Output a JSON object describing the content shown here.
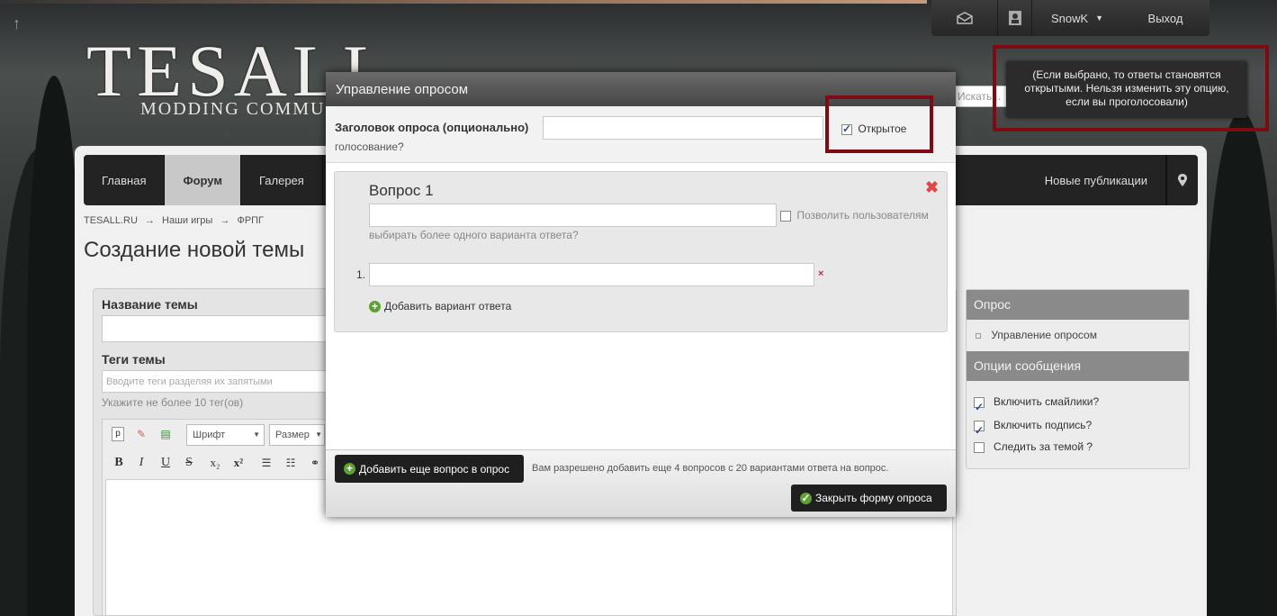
{
  "header": {
    "logo_text": "TESALL",
    "logo_sub": "MODDING COMMUNITY",
    "user_name": "SnowK",
    "logout": "Выход",
    "search_placeholder": "Искать...",
    "tooltip": "(Если выбрано, то ответы становятся открытыми. Нельзя изменить эту опцию, если вы проголосовали)"
  },
  "nav": {
    "items": [
      "Главная",
      "Форум",
      "Галерея"
    ],
    "new_posts": "Новые публикации"
  },
  "breadcrumb": [
    "TESALL.RU",
    "→",
    "Наши игры",
    "→",
    "ФРПГ"
  ],
  "page_title": "Создание новой темы",
  "form": {
    "topic_label": "Название темы",
    "tags_label": "Теги темы",
    "tags_placeholder": "Вводите теги разделяя их запятыми",
    "tags_hint": "Укажите не более 10 тег(ов)",
    "font_select": "Шрифт",
    "size_select": "Размер",
    "toolbar_icons": [
      "p",
      "✎",
      "▤",
      "B",
      "I",
      "U",
      "S",
      "x₂",
      "x²",
      "☰",
      "☷",
      "⚭"
    ]
  },
  "sidebar": {
    "poll_title": "Опрос",
    "poll_manage": "Управление опросом",
    "options_title": "Опции сообщения",
    "options": [
      {
        "label": "Включить смайлики?",
        "checked": true
      },
      {
        "label": "Включить подпись?",
        "checked": true
      },
      {
        "label": "Следить за темой ?",
        "checked": false
      }
    ]
  },
  "modal": {
    "title": "Управление опросом",
    "poll_title_label": "Заголовок опроса (опционально)",
    "poll_title_value": "",
    "open_vote_label": "Открытое",
    "open_vote_label_2": "голосование?",
    "open_vote_checked": true,
    "question_title": "Вопрос 1",
    "question_value": "",
    "multi_answer_label": "Позволить пользователям",
    "multi_answer_label_2": "выбирать более одного варианта ответа?",
    "answer_number": "1.",
    "answer_value": "",
    "add_answer": "Добавить вариант ответа",
    "add_question_button": "Добавить еще вопрос в опрос",
    "limits_note": "Вам разрешено добавить еще 4 вопросов с 20 вариантами ответа на вопрос.",
    "close_button": "Закрыть форму опроса"
  }
}
